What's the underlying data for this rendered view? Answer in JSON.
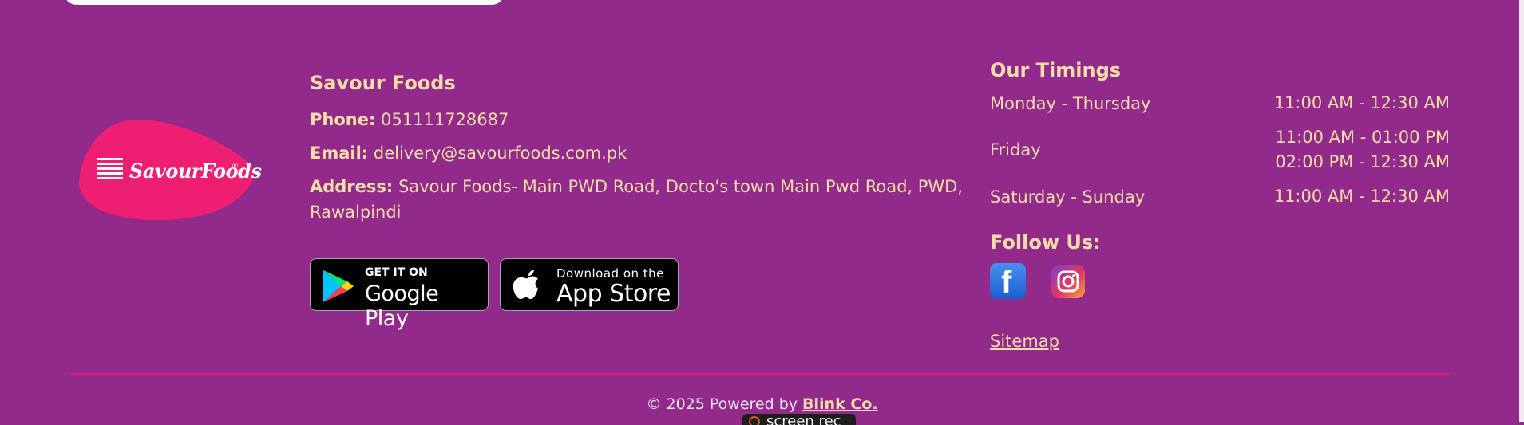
{
  "brand": {
    "logo_text": "SavourFoods",
    "logo_color": "#ee1f72"
  },
  "contact": {
    "title": "Savour Foods",
    "phone_label": "Phone:",
    "phone_value": "051111728687",
    "email_label": "Email:",
    "email_value": "delivery@savourfoods.com.pk",
    "address_label": "Address:",
    "address_value": "Savour Foods- Main PWD Road, Docto's town Main Pwd Road, PWD, Rawalpindi"
  },
  "stores": {
    "google_small": "GET IT ON",
    "google_big": "Google Play",
    "apple_small": "Download on the",
    "apple_big": "App Store"
  },
  "timings": {
    "title": "Our Timings",
    "rows": [
      {
        "day": "Monday - Thursday",
        "time1": "11:00 AM - 12:30 AM"
      },
      {
        "day": "Friday",
        "time1": "11:00 AM - 01:00 PM",
        "time2": "02:00 PM - 12:30 AM"
      },
      {
        "day": "Saturday - Sunday",
        "time1": "11:00 AM - 12:30 AM"
      }
    ]
  },
  "follow": {
    "title": "Follow Us:",
    "icons": [
      "facebook-icon",
      "instagram-icon"
    ]
  },
  "sitemap": "Sitemap",
  "footer": {
    "prefix": "© 2025 Powered by",
    "link": "Blink Co."
  },
  "recorder_badge": "screen rec",
  "colors": {
    "background": "#922a8b",
    "text": "#f7dca7",
    "divider": "#e0187a"
  }
}
